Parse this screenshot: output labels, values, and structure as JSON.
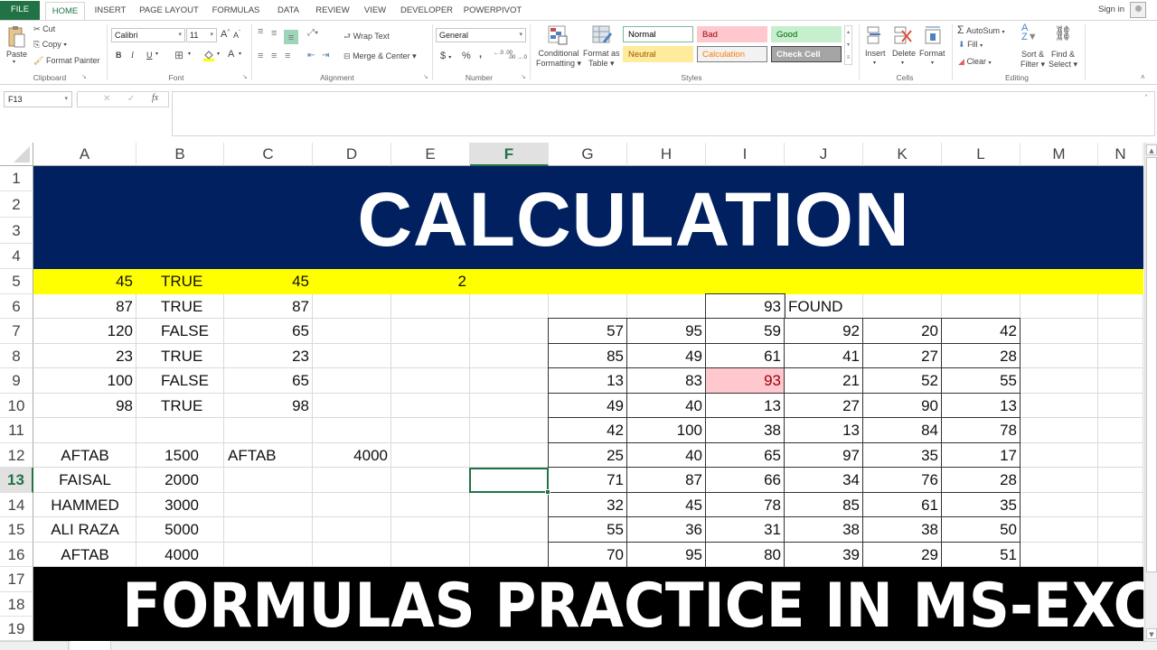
{
  "ribbon": {
    "tabs": [
      "FILE",
      "HOME",
      "INSERT",
      "PAGE LAYOUT",
      "FORMULAS",
      "DATA",
      "REVIEW",
      "VIEW",
      "DEVELOPER",
      "POWERPIVOT"
    ],
    "active_tab": "HOME",
    "sign_in": "Sign in",
    "clipboard": {
      "label": "Clipboard",
      "paste": "Paste",
      "cut": "Cut",
      "copy": "Copy",
      "format_painter": "Format Painter"
    },
    "font": {
      "label": "Font",
      "name": "Calibri",
      "size": "11",
      "bold": "B",
      "italic": "I",
      "underline": "U"
    },
    "alignment": {
      "label": "Alignment",
      "wrap_text": "Wrap Text",
      "merge_center": "Merge & Center"
    },
    "number": {
      "label": "Number",
      "format": "General",
      "currency": "$",
      "percent": "%",
      "comma": ",",
      "inc_decimal": "←.0 .00",
      "dec_decimal": ".00 →.0"
    },
    "styles": {
      "label": "Styles",
      "conditional_formatting": [
        "Conditional",
        "Formatting"
      ],
      "format_as_table": [
        "Format as",
        "Table"
      ],
      "cells": [
        {
          "name": "Normal",
          "bg": "#ffffff",
          "fg": "#000000",
          "border": "#7fb89a"
        },
        {
          "name": "Bad",
          "bg": "#ffc7ce",
          "fg": "#9c0006",
          "border": "#ffc7ce"
        },
        {
          "name": "Good",
          "bg": "#c6efce",
          "fg": "#006100",
          "border": "#c6efce"
        },
        {
          "name": "Neutral",
          "bg": "#ffeb9c",
          "fg": "#9c5700",
          "border": "#ffeb9c"
        },
        {
          "name": "Calculation",
          "bg": "#f2f2f2",
          "fg": "#fa7d00",
          "border": "#7f7f7f"
        },
        {
          "name": "Check Cell",
          "bg": "#a5a5a5",
          "fg": "#ffffff",
          "border": "#3f3f3f"
        }
      ]
    },
    "cells_group": {
      "label": "Cells",
      "insert": "Insert",
      "delete": "Delete",
      "format": "Format"
    },
    "editing": {
      "label": "Editing",
      "autosum": "AutoSum",
      "fill": "Fill",
      "clear": "Clear",
      "sort_filter": [
        "Sort &",
        "Filter"
      ],
      "find_select": [
        "Find &",
        "Select"
      ]
    }
  },
  "formula_bar": {
    "name_box": "F13",
    "cancel": "✕",
    "enter": "✓",
    "fx": "fx",
    "value": ""
  },
  "sheet": {
    "columns": [
      "A",
      "B",
      "C",
      "D",
      "E",
      "F",
      "G",
      "H",
      "I",
      "J",
      "K",
      "L",
      "M",
      "N"
    ],
    "selected_column": "F",
    "rows": [
      "1",
      "2",
      "3",
      "4",
      "5",
      "6",
      "7",
      "8",
      "9",
      "10",
      "11",
      "12",
      "13",
      "14",
      "15",
      "16",
      "17",
      "18",
      "19"
    ],
    "selected_row": "13",
    "title": "CALCULATION",
    "footer": "FORMULAS PRACTICE IN MS-EXCEL",
    "colors": {
      "title_bg": "#002060",
      "yellow": "#ffff00",
      "footer_bg": "#000000",
      "highlight": "#ffc7ce",
      "highlight_text": "#9c0006",
      "accent": "#217346"
    },
    "left_block": [
      {
        "row": 5,
        "A": "45",
        "B": "TRUE",
        "C": "45",
        "E": "2"
      },
      {
        "row": 6,
        "A": "87",
        "B": "TRUE",
        "C": "87"
      },
      {
        "row": 7,
        "A": "120",
        "B": "FALSE",
        "C": "65"
      },
      {
        "row": 8,
        "A": "23",
        "B": "TRUE",
        "C": "23"
      },
      {
        "row": 9,
        "A": "100",
        "B": "FALSE",
        "C": "65"
      },
      {
        "row": 10,
        "A": "98",
        "B": "TRUE",
        "C": "98"
      }
    ],
    "names_block": [
      {
        "row": 12,
        "A": "AFTAB",
        "B": "1500",
        "C": "AFTAB",
        "D": "4000"
      },
      {
        "row": 13,
        "A": "FAISAL",
        "B": "2000"
      },
      {
        "row": 14,
        "A": "HAMMED",
        "B": "3000"
      },
      {
        "row": 15,
        "A": "ALI RAZA",
        "B": "5000"
      },
      {
        "row": 16,
        "A": "AFTAB",
        "B": "4000"
      }
    ],
    "lookup": {
      "value": "93",
      "result": "FOUND"
    },
    "matrix_columns": [
      "G",
      "H",
      "I",
      "J",
      "K",
      "L"
    ],
    "matrix": [
      [
        "57",
        "95",
        "59",
        "92",
        "20",
        "42"
      ],
      [
        "85",
        "49",
        "61",
        "41",
        "27",
        "28"
      ],
      [
        "13",
        "83",
        "93",
        "21",
        "52",
        "55"
      ],
      [
        "49",
        "40",
        "13",
        "27",
        "90",
        "13"
      ],
      [
        "42",
        "100",
        "38",
        "13",
        "84",
        "78"
      ],
      [
        "25",
        "40",
        "65",
        "97",
        "35",
        "17"
      ],
      [
        "71",
        "87",
        "66",
        "34",
        "76",
        "28"
      ],
      [
        "32",
        "45",
        "78",
        "85",
        "61",
        "35"
      ],
      [
        "55",
        "36",
        "31",
        "38",
        "38",
        "50"
      ],
      [
        "70",
        "95",
        "80",
        "39",
        "29",
        "51"
      ]
    ],
    "highlighted_cell": {
      "row_index": 2,
      "col_index": 2
    }
  }
}
